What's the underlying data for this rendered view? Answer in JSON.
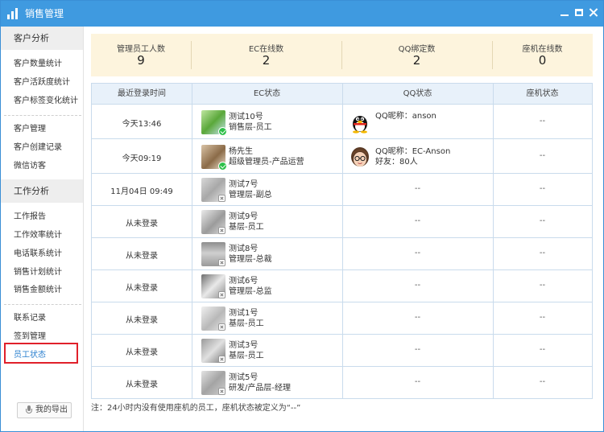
{
  "window": {
    "title": "销售管理"
  },
  "sidebar": {
    "sections": [
      {
        "header": "客户分析",
        "items": [
          "客户数量统计",
          "客户活跃度统计",
          "客户标签变化统计"
        ]
      },
      {
        "items": [
          "客户管理",
          "客户创建记录",
          "微信访客"
        ]
      },
      {
        "header": "工作分析",
        "items": [
          "工作报告",
          "工作效率统计",
          "电话联系统计",
          "销售计划统计",
          "销售金额统计"
        ]
      },
      {
        "items": [
          "联系记录",
          "签到管理",
          "员工状态"
        ]
      }
    ],
    "active_item": "员工状态",
    "export_label": "我的导出"
  },
  "stats": [
    {
      "label": "管理员工人数",
      "value": "9"
    },
    {
      "label": "EC在线数",
      "value": "2"
    },
    {
      "label": "QQ绑定数",
      "value": "2"
    },
    {
      "label": "座机在线数",
      "value": "0"
    }
  ],
  "table": {
    "headers": [
      "最近登录时间",
      "EC状态",
      "QQ状态",
      "座机状态"
    ],
    "rows": [
      {
        "time": "今天13:46",
        "name": "测试10号",
        "role": "销售层-员工",
        "ec_status": "online",
        "qq_line1": "QQ昵称：anson",
        "qq_line2": "",
        "qq_icon": "qq-penguin-icon",
        "phone": "--"
      },
      {
        "time": "今天09:19",
        "name": "杨先生",
        "role": "超级管理员-产品运营",
        "ec_status": "online",
        "qq_line1": "QQ昵称：EC-Anson",
        "qq_line2": "好友：80人",
        "qq_icon": "qq-cartoon-avatar",
        "phone": "--"
      },
      {
        "time": "11月04日 09:49",
        "name": "测试7号",
        "role": "管理层-副总",
        "ec_status": "offline",
        "qq": "--",
        "phone": "--"
      },
      {
        "time": "从未登录",
        "name": "测试9号",
        "role": "基层-员工",
        "ec_status": "offline",
        "qq": "--",
        "phone": "--"
      },
      {
        "time": "从未登录",
        "name": "测试8号",
        "role": "管理层-总裁",
        "ec_status": "offline",
        "qq": "--",
        "phone": "--"
      },
      {
        "time": "从未登录",
        "name": "测试6号",
        "role": "管理层-总监",
        "ec_status": "offline",
        "qq": "--",
        "phone": "--"
      },
      {
        "time": "从未登录",
        "name": "测试1号",
        "role": "基层-员工",
        "ec_status": "offline",
        "qq": "--",
        "phone": "--"
      },
      {
        "time": "从未登录",
        "name": "测试3号",
        "role": "基层-员工",
        "ec_status": "offline",
        "qq": "--",
        "phone": "--"
      },
      {
        "time": "从未登录",
        "name": "测试5号",
        "role": "研发/产品层-经理",
        "ec_status": "offline",
        "qq": "--",
        "phone": "--"
      }
    ]
  },
  "footnote": "注：24小时内没有使用座机的员工，座机状态被定义为“--”",
  "colors": {
    "titlebar": "#3f9ae0",
    "stats_bg": "#fdf4dd",
    "header_bg": "#e8f1fa",
    "active_link": "#2a7fcf",
    "highlight_box": "#e0202a"
  }
}
